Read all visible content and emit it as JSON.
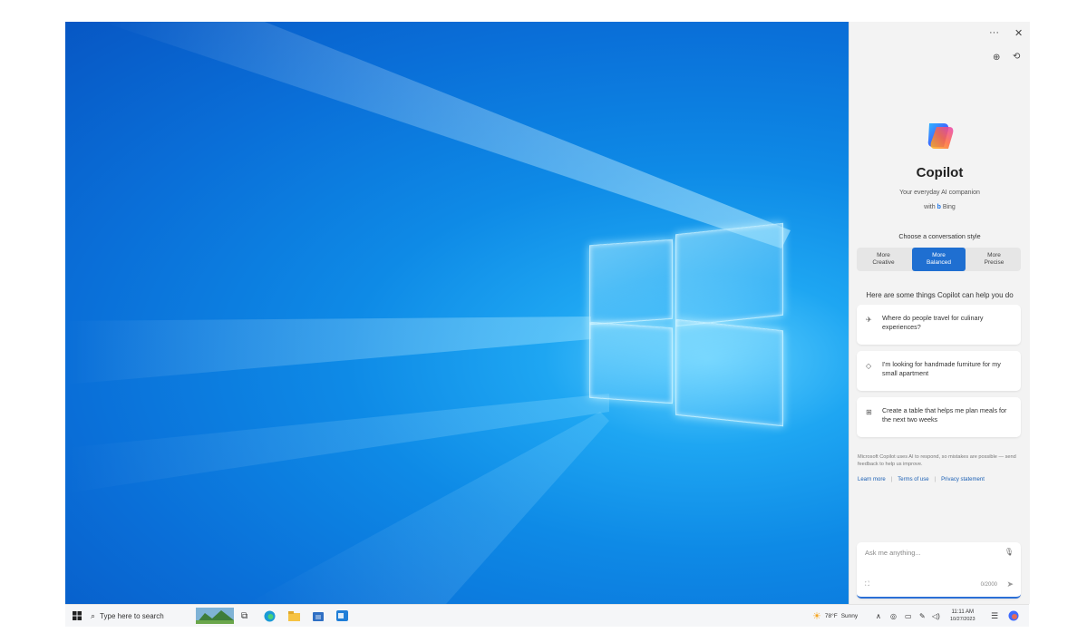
{
  "copilot": {
    "more_icon": "ellipsis-icon",
    "close_icon": "close-icon",
    "title": "Copilot",
    "tagline": "Your everyday AI companion",
    "with_label": "with",
    "bing_label": "Bing",
    "style_heading": "Choose a conversation style",
    "styles": [
      {
        "line1": "More",
        "line2": "Creative"
      },
      {
        "line1": "More",
        "line2": "Balanced"
      },
      {
        "line1": "More",
        "line2": "Precise"
      }
    ],
    "help_heading": "Here are some things Copilot can help you do",
    "suggestions": [
      {
        "icon": "airplane-icon",
        "text": "Where do people travel for culinary experiences?"
      },
      {
        "icon": "tag-icon",
        "text": "I'm looking for handmade furniture for my small apartment"
      },
      {
        "icon": "table-icon",
        "text": "Create a table that helps me plan meals for the next two weeks"
      }
    ],
    "disclaimer": "Microsoft Copilot uses AI to respond, so mistakes are possible — send feedback to help us improve.",
    "links": [
      "Learn more",
      "Terms of use",
      "Privacy statement"
    ],
    "input_placeholder": "Ask me anything...",
    "char_count": "0/2000"
  },
  "taskbar": {
    "search_placeholder": "Type here to search",
    "weather_temp": "78°F",
    "weather_desc": "Sunny",
    "time": "11:11 AM",
    "date": "10/27/2023"
  },
  "colors": {
    "accent": "#1f6fd1",
    "desktop_blue": "#0a6fd8",
    "panel_bg": "#f3f3f3"
  }
}
